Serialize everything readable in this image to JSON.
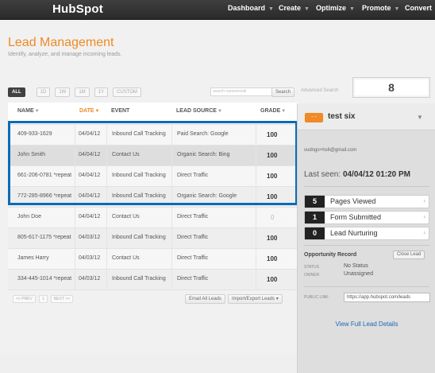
{
  "topbar": {
    "logo": "HubSpot",
    "nav": [
      "Dashboard",
      "Create",
      "Optimize",
      "Promote",
      "Convert"
    ]
  },
  "page": {
    "title": "Lead Management",
    "subtitle": "Identify, analyze, and manage incoming leads."
  },
  "filters": {
    "buttons": [
      "ALL",
      "1D",
      "1W",
      "1M",
      "1Y",
      "CUSTOM"
    ],
    "search_placeholder": "search name/email",
    "search_button": "Search",
    "advanced": "Advanced Search",
    "lead_count": "8"
  },
  "table": {
    "headers": {
      "name": "NAME",
      "date": "DATE",
      "event": "EVENT",
      "lead_source": "LEAD SOURCE",
      "grade": "GRADE"
    },
    "rows": [
      {
        "name": "409-933-1629",
        "date": "04/04/12",
        "event": "Inbound Call Tracking",
        "source": "Paid Search: Google",
        "grade": "100"
      },
      {
        "name": "John Smith",
        "date": "04/04/12",
        "event": "Contact Us",
        "source": "Organic Search: Bing",
        "grade": "100"
      },
      {
        "name": "661-206-0781 *repeat",
        "date": "04/04/12",
        "event": "Inbound Call Tracking",
        "source": "Direct Traffic",
        "grade": "100"
      },
      {
        "name": "772-285-8966 *repeat",
        "date": "04/04/12",
        "event": "Inbound Call Tracking",
        "source": "Organic Search: Google",
        "grade": "100"
      },
      {
        "name": "John Doe",
        "date": "04/04/12",
        "event": "Contact Us",
        "source": "Direct Traffic",
        "grade": "0"
      },
      {
        "name": "805-617-1175 *repeat",
        "date": "04/03/12",
        "event": "Inbound Call Tracking",
        "source": "Direct Traffic",
        "grade": "100"
      },
      {
        "name": "James Harry",
        "date": "04/03/12",
        "event": "Contact Us",
        "source": "Direct Traffic",
        "grade": "100"
      },
      {
        "name": "334-445-1014 *repeat",
        "date": "04/03/12",
        "event": "Inbound Call Tracking",
        "source": "Direct Traffic",
        "grade": "100"
      }
    ],
    "pager_prev": "<< PREV",
    "pager_page": "1",
    "pager_next": "NEXT >>",
    "email_all": "Email All Leads",
    "import_export": "Import/Export Leads"
  },
  "lead_panel": {
    "tag": "- -",
    "name": "test six",
    "email": "vudngo+hs6@gmail.com",
    "last_seen_label": "Last seen:",
    "last_seen_value": "04/04/12 01:20 PM",
    "stats": [
      {
        "count": "5",
        "label": "Pages Viewed"
      },
      {
        "count": "1",
        "label": "Form Submitted"
      },
      {
        "count": "0",
        "label": "Lead Nurturing"
      }
    ],
    "opportunity_title": "Opportunity Record",
    "close_lead": "Close Lead",
    "status_label": "STATUS",
    "status_value": "No Status",
    "owner_label": "OWNER",
    "owner_value": "Unassigned",
    "public_link_label": "PUBLIC LINK:",
    "public_link_value": "https://app.hubspot.com/leads",
    "view_full": "View Full Lead Details"
  },
  "colors": {
    "accent_orange": "#f08a24",
    "highlight_blue": "#0a6bb6",
    "link_blue": "#1b68b5"
  }
}
